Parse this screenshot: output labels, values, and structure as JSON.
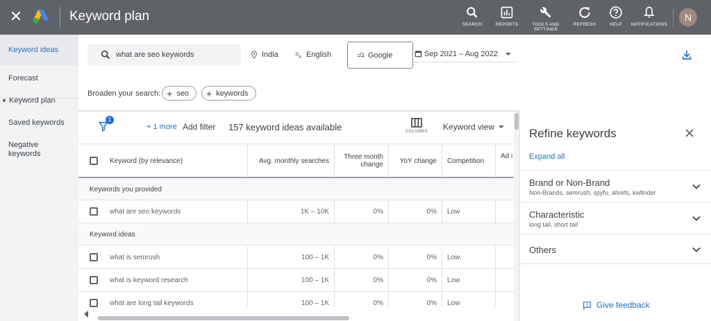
{
  "app": {
    "title": "Keyword plan",
    "avatar_letter": "N"
  },
  "toolbar": [
    {
      "label": "SEARCH",
      "icon": "search-icon"
    },
    {
      "label": "REPORTS",
      "icon": "reports-icon"
    },
    {
      "label": "TOOLS AND SETTINGS",
      "icon": "wrench-icon"
    },
    {
      "label": "REFRESH",
      "icon": "refresh-icon"
    },
    {
      "label": "HELP",
      "icon": "help-icon"
    },
    {
      "label": "NOTIFICATIONS",
      "icon": "bell-icon"
    }
  ],
  "sidebar": {
    "active": "Keyword ideas",
    "items": [
      "Forecast",
      "Keyword plan",
      "Saved keywords",
      "Negative keywords"
    ]
  },
  "search": {
    "query": "what are seo keywords"
  },
  "filters": {
    "location": "India",
    "language": "English",
    "network": "Google",
    "date_range": "Sep 2021 – Aug 2022"
  },
  "broaden": {
    "label": "Broaden your search:",
    "chips": [
      "seo",
      "keywords"
    ]
  },
  "table_toolbar": {
    "badge": "1",
    "more": "+ 1 more",
    "add_filter": "Add filter",
    "count": "157 keyword ideas available",
    "columns": "COLUMNS",
    "view": "Keyword view"
  },
  "table": {
    "headers": [
      "Keyword (by relevance)",
      "Avg. monthly searches",
      "Three month change",
      "YoY change",
      "Competition",
      "Ad i"
    ],
    "groups": [
      {
        "title": "Keywords you provided",
        "rows": [
          [
            "what are seo keywords",
            "1K – 10K",
            "0%",
            "0%",
            "Low"
          ]
        ]
      },
      {
        "title": "Keyword ideas",
        "rows": [
          [
            "what is semrush",
            "100 – 1K",
            "0%",
            "0%",
            "Low"
          ],
          [
            "what is keyword research",
            "100 – 1K",
            "0%",
            "0%",
            "Low"
          ],
          [
            "what are long tail keywords",
            "100 – 1K",
            "0%",
            "0%",
            "Low"
          ]
        ]
      }
    ]
  },
  "refine": {
    "title": "Refine keywords",
    "expand_all": "Expand all",
    "sections": [
      {
        "title": "Brand or Non-Brand",
        "subtitle": "Non-Brands, semrush, spyfu, ahrefs, kwfinder"
      },
      {
        "title": "Characteristic",
        "subtitle": "long tail, short tail"
      },
      {
        "title": "Others",
        "subtitle": ""
      }
    ],
    "feedback": "Give feedback"
  },
  "colors": {
    "topbar": "#5f6368",
    "accent": "#1a73e8",
    "avatar": "#a1887f"
  }
}
